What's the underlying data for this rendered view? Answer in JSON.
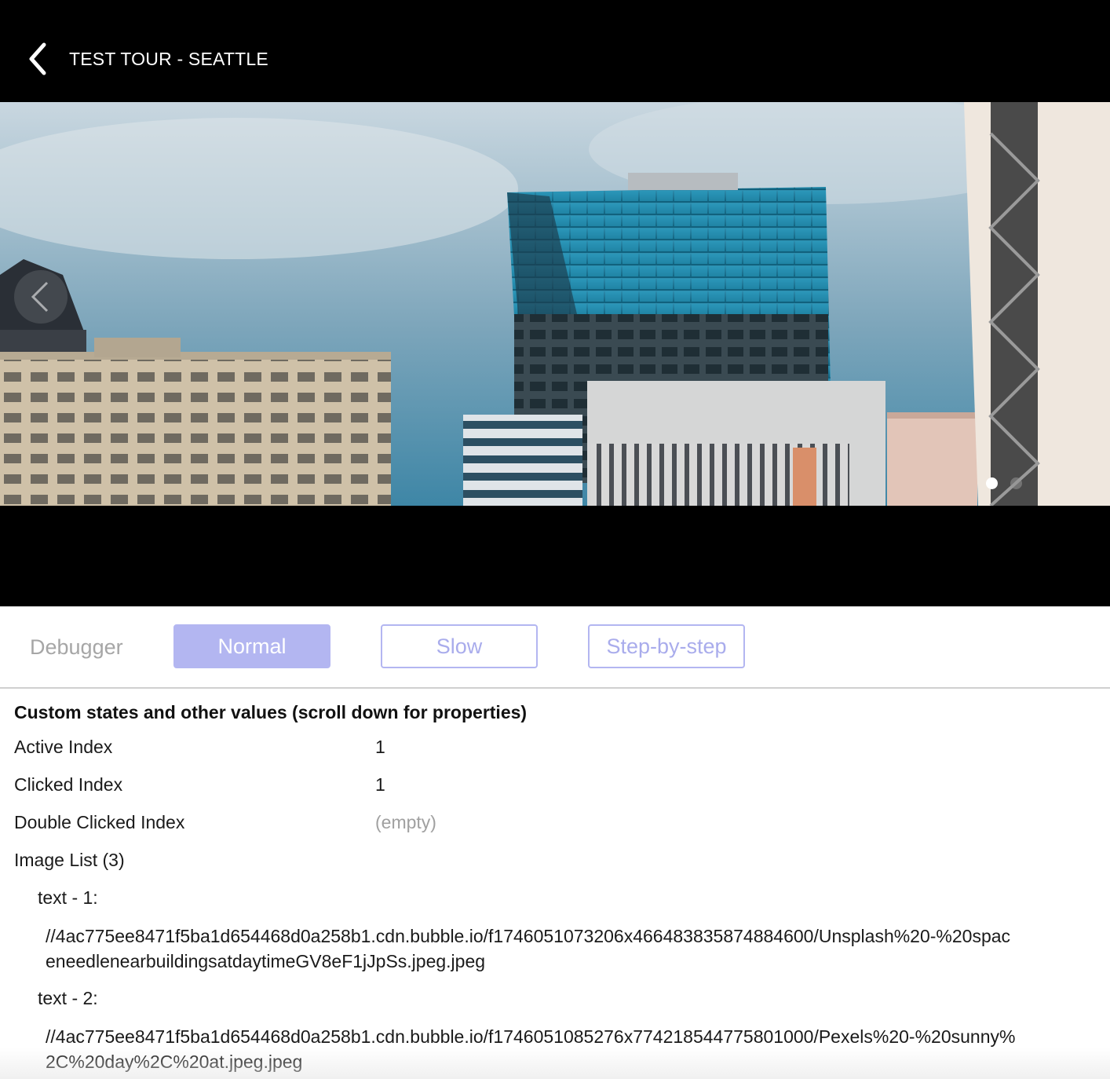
{
  "header": {
    "title": "TEST TOUR - SEATTLE",
    "back_icon": "chevron-left-icon",
    "background": "#000000"
  },
  "slider": {
    "image_description": "Seattle buildings at daytime",
    "prev_icon": "chevron-left-icon",
    "dot_count": 2,
    "active_dot": 1
  },
  "debugger": {
    "label": "Debugger",
    "modes": {
      "normal": "Normal",
      "slow": "Slow",
      "step": "Step-by-step"
    },
    "active_mode": "Normal",
    "accent_color": "#b3b6f1"
  },
  "inspector": {
    "title": "Custom states and other values (scroll down for properties)",
    "active_index": {
      "label": "Active Index",
      "value": "1"
    },
    "clicked_index": {
      "label": "Clicked Index",
      "value": "1"
    },
    "double_clicked_index": {
      "label": "Double Clicked Index",
      "value": "(empty)"
    },
    "image_list": {
      "label": "Image List (3)",
      "items": [
        {
          "label": "text - 1:",
          "value": "//4ac775ee8471f5ba1d654468d0a258b1.cdn.bubble.io/f1746051073206x466483835874884600/Unsplash%20-%20spaceneedlenearbuildingsatdaytimeGV8eF1jJpSs.jpeg.jpeg"
        },
        {
          "label": "text - 2:",
          "value": "//4ac775ee8471f5ba1d654468d0a258b1.cdn.bubble.io/f1746051085276x774218544775801000/Pexels%20-%20sunny%2C%20day%2C%20at.jpeg.jpeg"
        }
      ]
    }
  }
}
